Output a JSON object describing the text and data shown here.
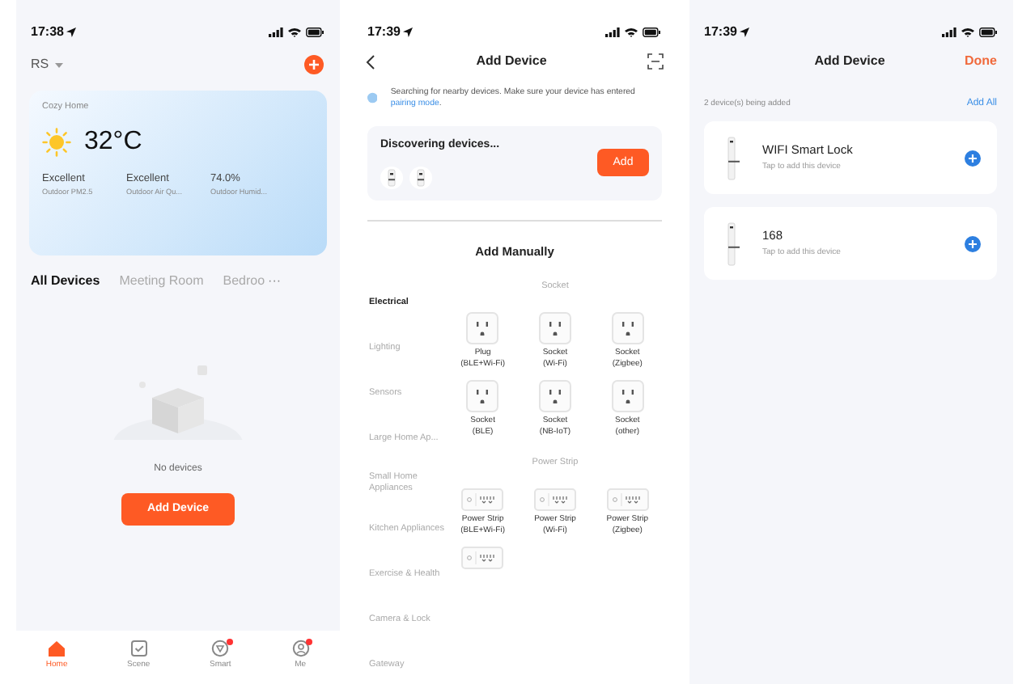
{
  "screens": [
    {
      "kind": "home",
      "time": "17:38",
      "home_name": "RS",
      "weather": {
        "place": "Cozy Home",
        "temperature": "32°C",
        "stats": [
          {
            "value": "Excellent",
            "label": "Outdoor PM2.5"
          },
          {
            "value": "Excellent",
            "label": "Outdoor Air Qu..."
          },
          {
            "value": "74.0%",
            "label": "Outdoor Humid..."
          }
        ]
      },
      "rooms": [
        {
          "label": "All Devices",
          "selected": true
        },
        {
          "label": "Meeting Room",
          "selected": false
        },
        {
          "label": "Bedroo",
          "selected": false
        }
      ],
      "more": "···",
      "empty_text": "No devices",
      "add_button": "Add Device",
      "nav": [
        {
          "label": "Home",
          "selected": true,
          "badge": false,
          "kind": "home"
        },
        {
          "label": "Scene",
          "selected": false,
          "badge": false,
          "kind": "scene"
        },
        {
          "label": "Smart",
          "selected": false,
          "badge": true,
          "kind": "smart"
        },
        {
          "label": "Me",
          "selected": false,
          "badge": true,
          "kind": "me"
        }
      ]
    },
    {
      "kind": "add_device",
      "time": "17:39",
      "title": "Add Device",
      "search_text": "Searching for nearby devices. Make sure your device has entered ",
      "search_link": "pairing mode",
      "search_end": ".",
      "discovering": "Discovering devices...",
      "add_button": "Add",
      "section_title": "Add Manually",
      "categories": [
        {
          "label": "Electrical",
          "selected": true
        },
        {
          "label": "Lighting",
          "selected": false
        },
        {
          "label": "Sensors",
          "selected": false
        },
        {
          "label": "Large Home Ap...",
          "selected": false
        },
        {
          "label": "Small Home Appliances",
          "selected": false
        },
        {
          "label": "Kitchen Appliances",
          "selected": false
        },
        {
          "label": "Exercise & Health",
          "selected": false
        },
        {
          "label": "Camera & Lock",
          "selected": false
        },
        {
          "label": "Gateway",
          "selected": false
        }
      ],
      "groups": [
        {
          "title": "Socket",
          "items": [
            {
              "kind": "socket",
              "name": "Plug",
              "variant": "(BLE+Wi-Fi)"
            },
            {
              "kind": "socket",
              "name": "Socket",
              "variant": "(Wi-Fi)"
            },
            {
              "kind": "socket",
              "name": "Socket",
              "variant": "(Zigbee)"
            },
            {
              "kind": "socket",
              "name": "Socket",
              "variant": "(BLE)"
            },
            {
              "kind": "socket",
              "name": "Socket",
              "variant": "(NB-IoT)"
            },
            {
              "kind": "socket",
              "name": "Socket",
              "variant": "(other)"
            }
          ]
        },
        {
          "title": "Power Strip",
          "items": [
            {
              "kind": "strip",
              "name": "Power Strip",
              "variant": "(BLE+Wi-Fi)"
            },
            {
              "kind": "strip",
              "name": "Power Strip",
              "variant": "(Wi-Fi)"
            },
            {
              "kind": "strip",
              "name": "Power Strip",
              "variant": "(Zigbee)"
            },
            {
              "kind": "strip"
            }
          ]
        }
      ]
    },
    {
      "kind": "adding",
      "time": "17:39",
      "title": "Add Device",
      "done": "Done",
      "count_text": "2 device(s) being added",
      "add_all": "Add All",
      "devices": [
        {
          "name": "WIFI Smart Lock",
          "hint": "Tap to add this device"
        },
        {
          "name": "168",
          "hint": "Tap to add this device"
        }
      ]
    }
  ]
}
